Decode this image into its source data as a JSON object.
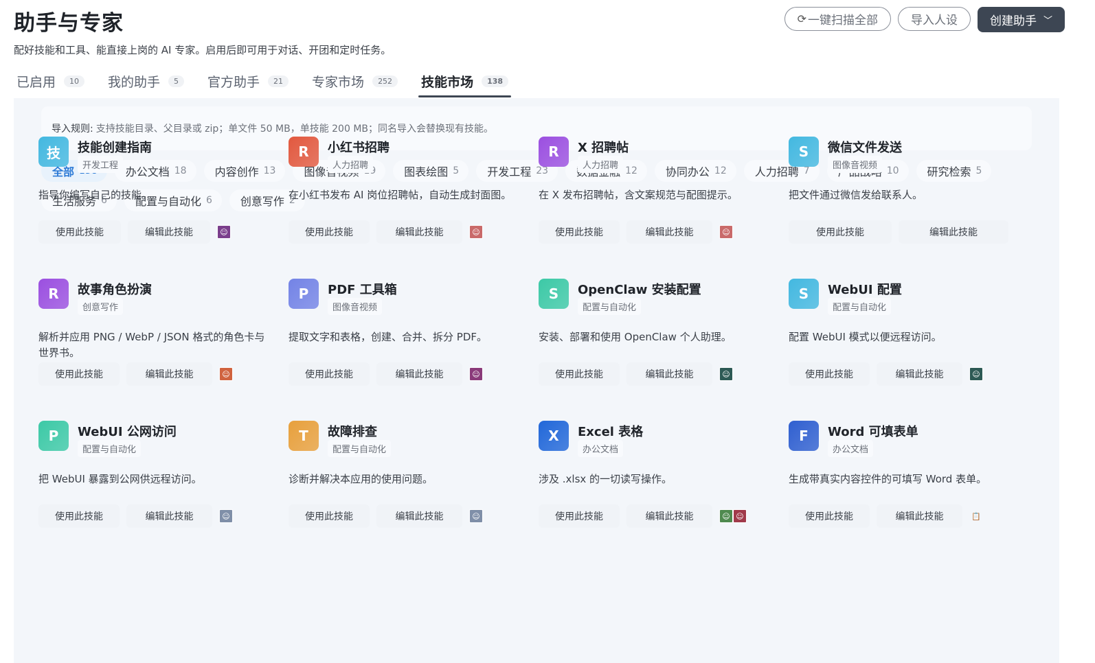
{
  "header": {
    "title": "助手与专家",
    "subtitle": "配好技能和工具、能直接上岗的 AI 专家。启用后即可用于对话、开团和定时任务。",
    "scan_all": "一键扫描全部",
    "import_persona": "导入人设",
    "create_assistant": "创建助手"
  },
  "tabs": [
    {
      "label": "已启用",
      "count": "10"
    },
    {
      "label": "我的助手",
      "count": "5"
    },
    {
      "label": "官方助手",
      "count": "21"
    },
    {
      "label": "专家市场",
      "count": "252"
    },
    {
      "label": "技能市场",
      "count": "138",
      "active": true
    }
  ],
  "import_rule": {
    "label": "导入规则:",
    "text": "支持技能目录、父目录或 zip；单文件 50 MB，单技能 200 MB；同名导入会替换现有技能。"
  },
  "categories": [
    {
      "label": "全部",
      "count": "138",
      "active": true
    },
    {
      "label": "办公文档",
      "count": "18"
    },
    {
      "label": "内容创作",
      "count": "13"
    },
    {
      "label": "图像音视频",
      "count": "19"
    },
    {
      "label": "图表绘图",
      "count": "5"
    },
    {
      "label": "开发工程",
      "count": "23"
    },
    {
      "label": "数据金融",
      "count": "12"
    },
    {
      "label": "协同办公",
      "count": "12"
    },
    {
      "label": "人力招聘",
      "count": "7"
    },
    {
      "label": "产品战略",
      "count": "10"
    },
    {
      "label": "研究检索",
      "count": "5"
    },
    {
      "label": "生活服务",
      "count": "6"
    },
    {
      "label": "配置与自动化",
      "count": "6"
    },
    {
      "label": "创意写作",
      "count": "2"
    }
  ],
  "actions": {
    "use": "使用此技能",
    "edit": "编辑此技能"
  },
  "skills": [
    {
      "icon_letter": "技",
      "color": "#43b8e0",
      "title": "技能创建指南",
      "category": "开发工程",
      "desc": "指导你编写自己的技能。",
      "avatars": [
        "#7b3f8c"
      ],
      "btn_layout": "a"
    },
    {
      "icon_letter": "R",
      "color": "#e2583e",
      "title": "小红书招聘",
      "category": "人力招聘",
      "desc": "在小红书发布 AI 岗位招聘帖，自动生成封面图。",
      "avatars": [
        "#c96a6a"
      ],
      "btn_layout": "b"
    },
    {
      "icon_letter": "R",
      "color": "#9b4fe0",
      "title": "X 招聘帖",
      "category": "人力招聘",
      "desc": "在 X 发布招聘帖，含文案规范与配图提示。",
      "avatars": [
        "#c96a6a"
      ],
      "btn_layout": "b"
    },
    {
      "icon_letter": "S",
      "color": "#43b8e0",
      "title": "微信文件发送",
      "category": "图像音视频",
      "desc": "把文件通过微信发给联系人。",
      "avatars": [],
      "btn_layout": "c"
    },
    {
      "icon_letter": "R",
      "color": "#9b4fe0",
      "title": "故事角色扮演",
      "category": "创意写作",
      "desc": "解析并应用 PNG / WebP / JSON 格式的角色卡与世界书。",
      "avatars": [
        "#d0633f"
      ],
      "btn_layout": "b"
    },
    {
      "icon_letter": "P",
      "color": "#7383e6",
      "title": "PDF 工具箱",
      "category": "图像音视频",
      "desc": "提取文字和表格，创建、合并、拆分 PDF。",
      "avatars": [
        "#8a3a7a"
      ],
      "btn_layout": "b"
    },
    {
      "icon_letter": "S",
      "color": "#3cc9a6",
      "title": "OpenClaw 安装配置",
      "category": "配置与自动化",
      "desc": "安装、部署和使用 OpenClaw 个人助理。",
      "avatars": [
        "#2d5a55"
      ],
      "btn_layout": "b"
    },
    {
      "icon_letter": "S",
      "color": "#43b8e0",
      "title": "WebUI 配置",
      "category": "配置与自动化",
      "desc": "配置 WebUI 模式以便远程访问。",
      "avatars": [
        "#2d5a55"
      ],
      "btn_layout": "b"
    },
    {
      "icon_letter": "P",
      "color": "#3cc9a6",
      "title": "WebUI 公网访问",
      "category": "配置与自动化",
      "desc": "把 WebUI 暴露到公网供远程访问。",
      "avatars": [
        "#7f8fa8"
      ],
      "btn_layout": "b"
    },
    {
      "icon_letter": "T",
      "color": "#e8a03c",
      "title": "故障排查",
      "category": "配置与自动化",
      "desc": "诊断并解决本应用的使用问题。",
      "avatars": [
        "#7f8fa8"
      ],
      "btn_layout": "b"
    },
    {
      "icon_letter": "X",
      "color": "#2167d9",
      "title": "Excel 表格",
      "category": "办公文档",
      "desc": "涉及 .xlsx 的一切读写操作。",
      "avatars": [
        "#4f8a4f",
        "#a03a4a"
      ],
      "btn_layout": "b"
    },
    {
      "icon_letter": "F",
      "color": "#2f5fd0",
      "title": "Word 可填表单",
      "category": "办公文档",
      "desc": "生成带真实内容控件的可填写 Word 表单。",
      "avatars": [
        "clipboard"
      ],
      "btn_layout": "b"
    }
  ]
}
